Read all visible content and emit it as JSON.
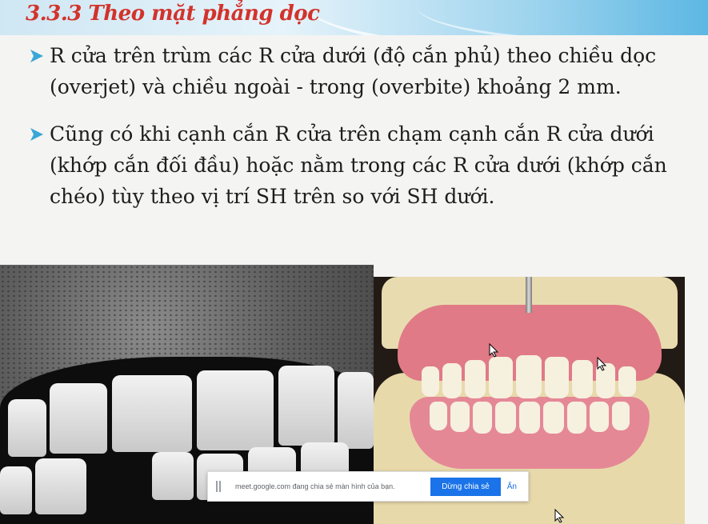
{
  "slide": {
    "title": "3.3.3 Theo mặt phẳng dọc",
    "bullets": [
      "R cửa trên trùm các R cửa dưới (độ cắn phủ) theo chiều dọc (overjet) và chiều ngoài - trong (overbite) khoảng 2 mm.",
      "Cũng có khi cạnh cắn R cửa trên chạm cạnh cắn R cửa dưới (khớp cắn đối đầu) hoặc nằm trong các R cửa dưới (khớp cắn chéo) tùy theo vị trí SH trên so với SH dưới."
    ]
  },
  "share_banner": {
    "message": "meet.google.com đang chia sẻ màn hình của bạn.",
    "stop_label": "Dừng chia sẻ",
    "hide_label": "Ẩn"
  },
  "colors": {
    "title": "#d2332b",
    "bullet_arrow": "#3aa6d8",
    "stop_button": "#1a73e8"
  },
  "icons": [
    "arrow-bullet-icon",
    "drag-handle-icon",
    "mouse-cursor-icon"
  ]
}
